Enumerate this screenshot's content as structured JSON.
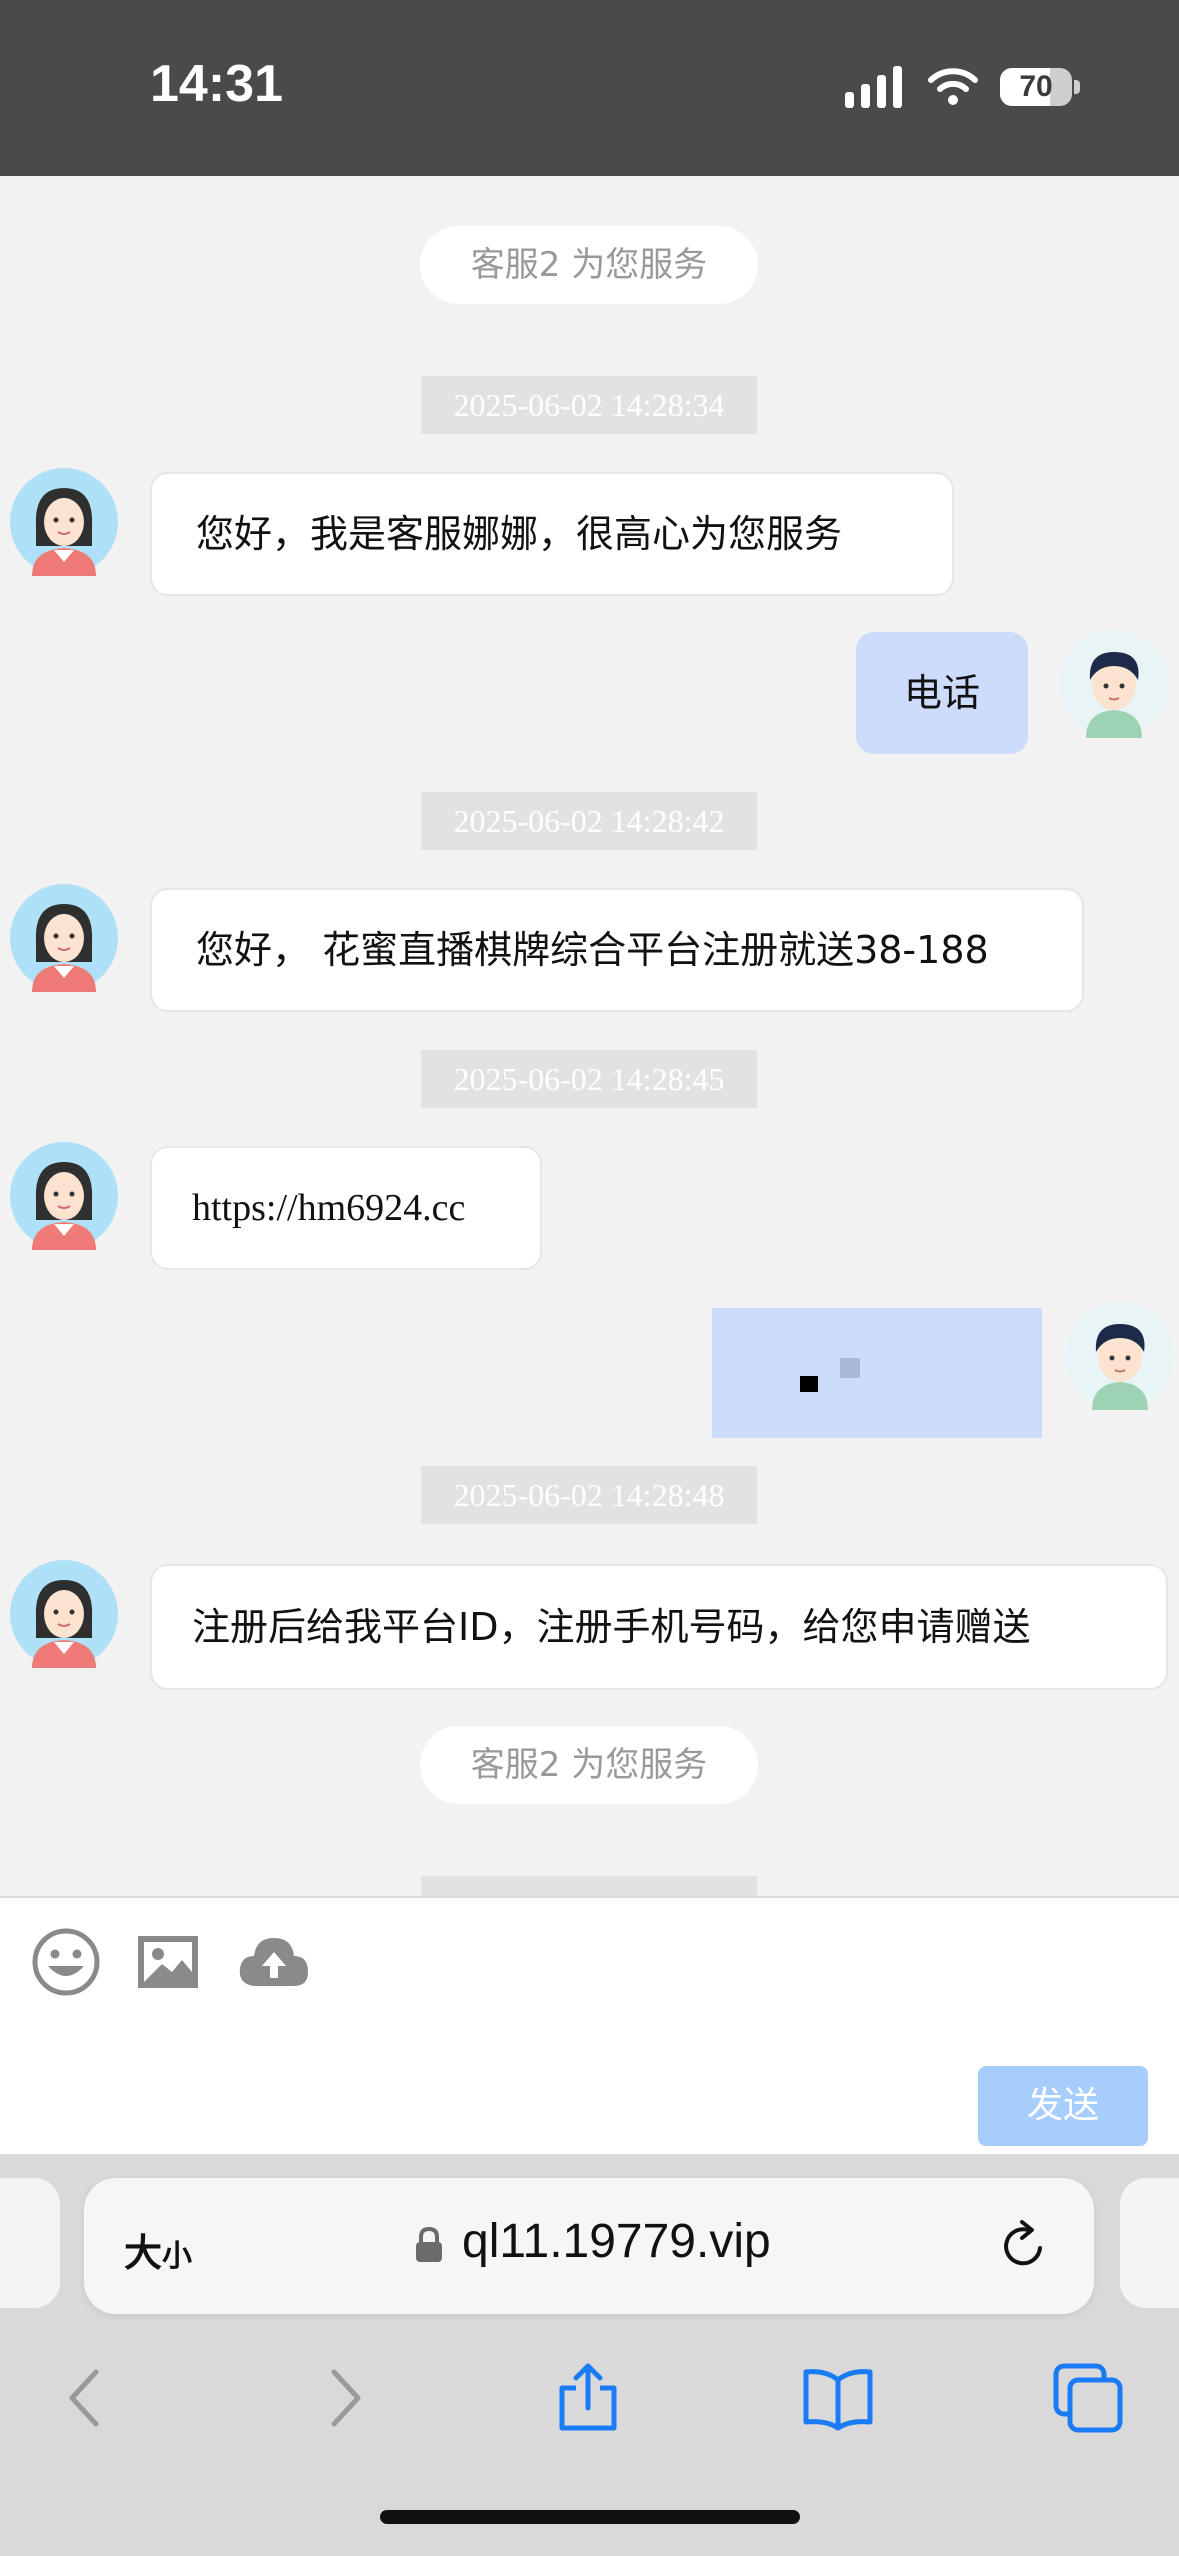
{
  "status_bar": {
    "time": "14:31",
    "battery": "70",
    "battery_level": 0.7
  },
  "chat": {
    "notices": [
      "客服2 为您服务",
      "客服2 为您服务"
    ],
    "timestamps": [
      "2025-06-02 14:28:34",
      "2025-06-02 14:28:42",
      "2025-06-02 14:28:45",
      "2025-06-02 14:28:48"
    ],
    "messages": [
      {
        "from": "agent",
        "text": "您好，我是客服娜娜，很高心为您服务"
      },
      {
        "from": "user",
        "text": "电话"
      },
      {
        "from": "agent",
        "text": "您好， 花蜜直播棋牌综合平台注册就送38-188"
      },
      {
        "from": "agent",
        "text": "https://hm6924.cc"
      },
      {
        "from": "user",
        "text": ""
      },
      {
        "from": "agent",
        "text": "注册后给我平台ID，注册手机号码，给您申请赠送"
      }
    ]
  },
  "composer": {
    "icons": [
      "emoji-icon",
      "image-icon",
      "upload-cloud-icon"
    ],
    "send_label": "发送"
  },
  "browser": {
    "text_size_label_big": "大",
    "text_size_label_small": "小",
    "url": "ql11.19779.vip"
  },
  "colors": {
    "status_bar_bg": "#4a4a4a",
    "chat_bg": "#f2f2f2",
    "user_bubble": "#cddcfb",
    "send_button": "#a6cdfb",
    "safari_blue": "#1a7cf5"
  }
}
